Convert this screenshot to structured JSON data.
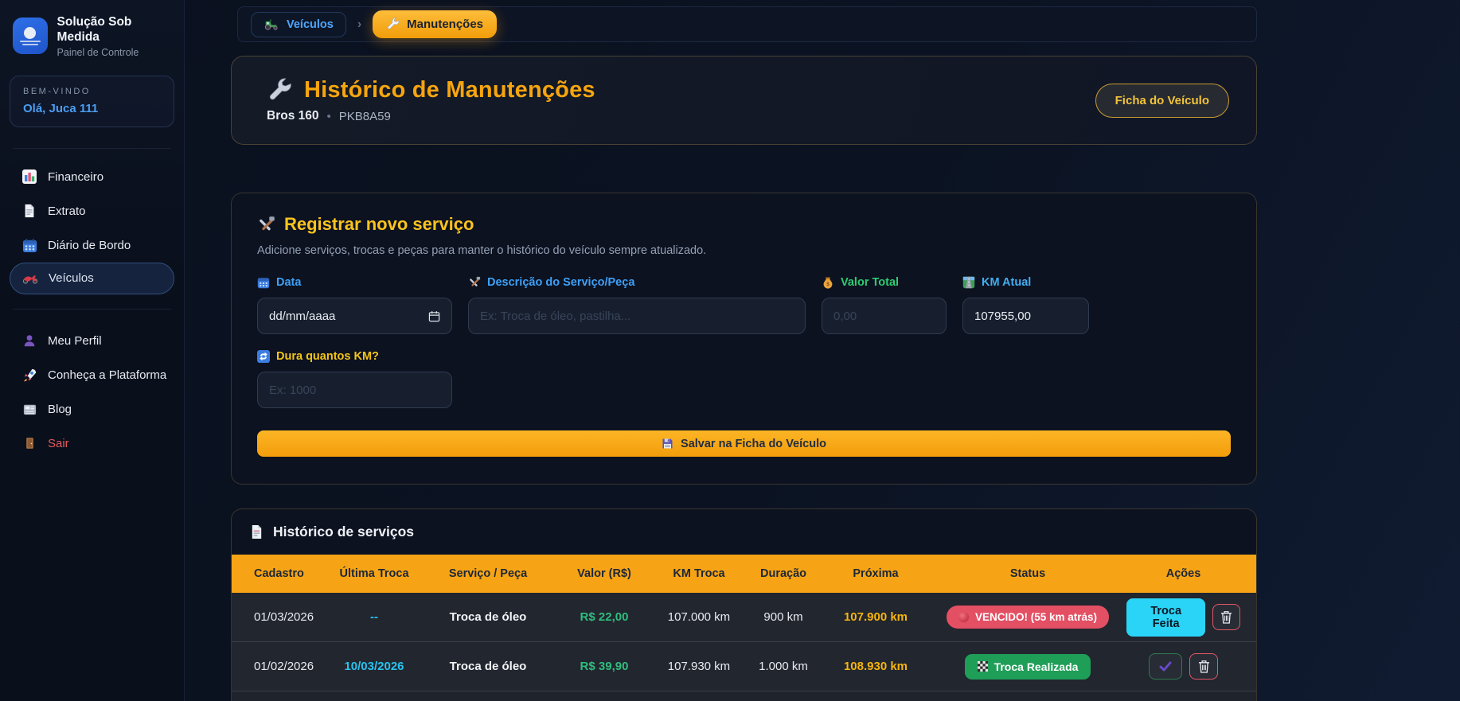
{
  "app": {
    "title": "Solução Sob Medida",
    "subtitle": "Painel de Controle"
  },
  "sidebar": {
    "welcome_label": "BEM-VINDO",
    "welcome_user": "Olá, Juca 111",
    "items": [
      {
        "label": "Financeiro",
        "icon": "bar-chart-icon"
      },
      {
        "label": "Extrato",
        "icon": "document-icon"
      },
      {
        "label": "Diário de Bordo",
        "icon": "calendar-icon"
      },
      {
        "label": "Veículos",
        "icon": "motorcycle-icon",
        "active": true
      },
      {
        "label": "Meu Perfil",
        "icon": "person-icon"
      },
      {
        "label": "Conheça a Plataforma",
        "icon": "rocket-icon"
      },
      {
        "label": "Blog",
        "icon": "newspaper-icon"
      },
      {
        "label": "Sair",
        "icon": "door-icon"
      }
    ]
  },
  "breadcrumb": {
    "separator": "›",
    "items": [
      {
        "label": "Veículos",
        "icon": "tractor-icon"
      },
      {
        "label": "Manutenções",
        "icon": "wrench-icon",
        "active": true
      }
    ]
  },
  "header": {
    "icon": "wrench-icon",
    "title": "Histórico de Manutenções",
    "vehicle_name": "Bros 160",
    "dot": "•",
    "vehicle_plate": "PKB8A59",
    "ficha_button": "Ficha do Veículo"
  },
  "form": {
    "icon": "hammer-wrench-icon",
    "title": "Registrar novo serviço",
    "subtitle": "Adicione serviços, trocas e peças para manter o histórico do veículo sempre atualizado.",
    "fields": {
      "data": {
        "label": "Data",
        "icon": "calendar-icon",
        "value": "dd/mm/aaaa"
      },
      "descricao": {
        "label": "Descrição do Serviço/Peça",
        "icon": "hammer-wrench-icon",
        "placeholder": "Ex: Troca de óleo, pastilha..."
      },
      "valor": {
        "label": "Valor Total",
        "icon": "money-bag-icon",
        "placeholder": "0,00"
      },
      "km_atual": {
        "label": "KM Atual",
        "icon": "motorway-icon",
        "value": "107955,00"
      },
      "dura_km": {
        "label": "Dura quantos KM?",
        "icon": "repeat-icon",
        "placeholder": "Ex: 1000"
      }
    },
    "save_button": {
      "icon": "floppy-disk-icon",
      "label": "Salvar na Ficha do Veículo"
    }
  },
  "table": {
    "icon": "document-icon",
    "title": "Histórico de serviços",
    "columns": [
      "Cadastro",
      "Última Troca",
      "Serviço / Peça",
      "Valor (R$)",
      "KM Troca",
      "Duração",
      "Próxima",
      "Status",
      "Ações"
    ],
    "rows": [
      {
        "cadastro": "01/03/2026",
        "ultima_troca": "--",
        "servico": "Troca de óleo",
        "valor": "R$ 22,00",
        "km_troca": "107.000 km",
        "duracao": "900 km",
        "proxima": "107.900 km",
        "status": {
          "label": "VENCIDO! (55 km atrás)",
          "type": "vencido",
          "icon": "red-circle-icon"
        },
        "actions": {
          "primary": "Troca Feita",
          "delete_icon": "trash-icon"
        }
      },
      {
        "cadastro": "01/02/2026",
        "ultima_troca": "10/03/2026",
        "servico": "Troca de óleo",
        "valor": "R$ 39,90",
        "km_troca": "107.930 km",
        "duracao": "1.000 km",
        "proxima": "108.930 km",
        "status": {
          "label": "Troca Realizada",
          "type": "realizada",
          "icon": "checkered-flag-icon"
        },
        "actions": {
          "confirm_icon": "check-icon",
          "delete_icon": "trash-icon"
        }
      }
    ]
  },
  "colors": {
    "accent_orange": "#f6a415",
    "accent_yellow": "#fbc31d",
    "link_blue": "#4da6ff",
    "cyan": "#2ad4f6",
    "green": "#2fbd7d",
    "red_badge": "#e34f63",
    "green_badge": "#1f9e58"
  }
}
